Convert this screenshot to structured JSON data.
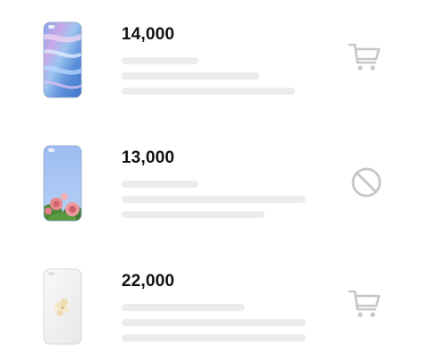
{
  "colors": {
    "skeleton": "#ececec",
    "price_text": "#111111",
    "icon_gray": "#c7c7c7"
  },
  "products": [
    {
      "price": "14,000",
      "case_design": "pastel-marble",
      "action_icon": "cart-icon",
      "action_state": "available"
    },
    {
      "price": "13,000",
      "case_design": "roses-sky",
      "action_icon": "unavailable-icon",
      "action_state": "unavailable"
    },
    {
      "price": "22,000",
      "case_design": "white-flowers",
      "action_icon": "cart-icon",
      "action_state": "available"
    }
  ]
}
